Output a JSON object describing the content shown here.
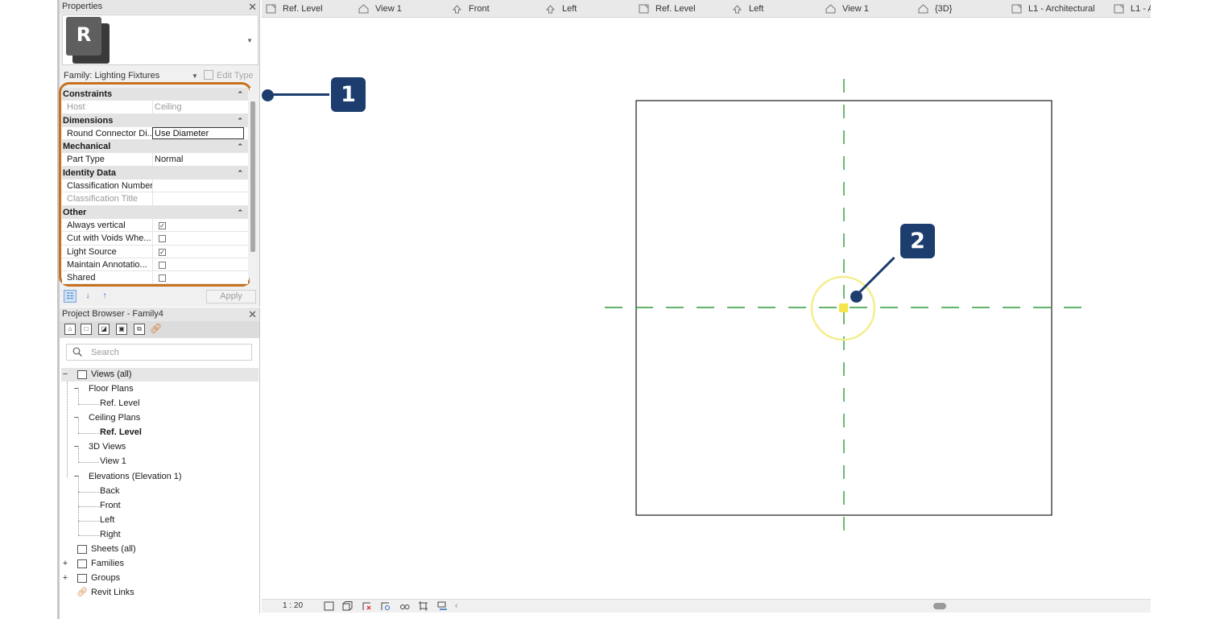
{
  "properties": {
    "title": "Properties",
    "logo_letter": "R",
    "family_label": "Family: Lighting Fixtures",
    "edit_type": "Edit Type",
    "groups": [
      {
        "name": "Constraints",
        "rows": [
          {
            "key": "Host",
            "value": "Ceiling",
            "dim": true
          }
        ]
      },
      {
        "name": "Dimensions",
        "rows": [
          {
            "key": "Round Connector Di...",
            "value": "Use Diameter",
            "edit": true
          }
        ]
      },
      {
        "name": "Mechanical",
        "rows": [
          {
            "key": "Part Type",
            "value": "Normal"
          }
        ]
      },
      {
        "name": "Identity Data",
        "rows": [
          {
            "key": "Classification Number",
            "value": ""
          },
          {
            "key": "Classification Title",
            "value": "",
            "dim": true
          }
        ]
      },
      {
        "name": "Other",
        "rows": [
          {
            "key": "Always vertical",
            "checked": true
          },
          {
            "key": "Cut with Voids Whe...",
            "checked": false
          },
          {
            "key": "Light Source",
            "checked": true
          },
          {
            "key": "Maintain Annotatio...",
            "checked": false
          },
          {
            "key": "Shared",
            "checked": false
          }
        ]
      }
    ],
    "apply": "Apply"
  },
  "browser": {
    "title": "Project Browser - Family4",
    "search_placeholder": "Search",
    "tree": {
      "views_all": "Views (all)",
      "floor_plans": "Floor Plans",
      "floor_ref_level": "Ref. Level",
      "ceiling_plans": "Ceiling Plans",
      "ceiling_ref_level": "Ref. Level",
      "views_3d": "3D Views",
      "view1": "View 1",
      "elevations": "Elevations (Elevation 1)",
      "back": "Back",
      "front": "Front",
      "left": "Left",
      "right": "Right",
      "sheets": "Sheets (all)",
      "families": "Families",
      "groups": "Groups",
      "revit_links": "Revit Links"
    }
  },
  "tabs": [
    {
      "label": "Ref. Level",
      "icon": "plan-icon"
    },
    {
      "label": "View 1",
      "icon": "house-icon"
    },
    {
      "label": "Front",
      "icon": "elevation-icon"
    },
    {
      "label": "Left",
      "icon": "elevation-icon"
    },
    {
      "label": "Ref. Level",
      "icon": "plan-icon"
    },
    {
      "label": "Left",
      "icon": "elevation-icon"
    },
    {
      "label": "View 1",
      "icon": "house-icon"
    },
    {
      "label": "{3D}",
      "icon": "house-icon"
    },
    {
      "label": "L1 - Architectural",
      "icon": "plan-icon"
    },
    {
      "label": "L1 - A",
      "icon": "plan-icon"
    }
  ],
  "status": {
    "scale": "1 : 20"
  },
  "callouts": {
    "one": "1",
    "two": "2"
  },
  "colors": {
    "accent": "#1c3d6e",
    "highlight": "#c8701e",
    "ref_plane": "#2e9b3a",
    "selection": "#f2e64a"
  }
}
